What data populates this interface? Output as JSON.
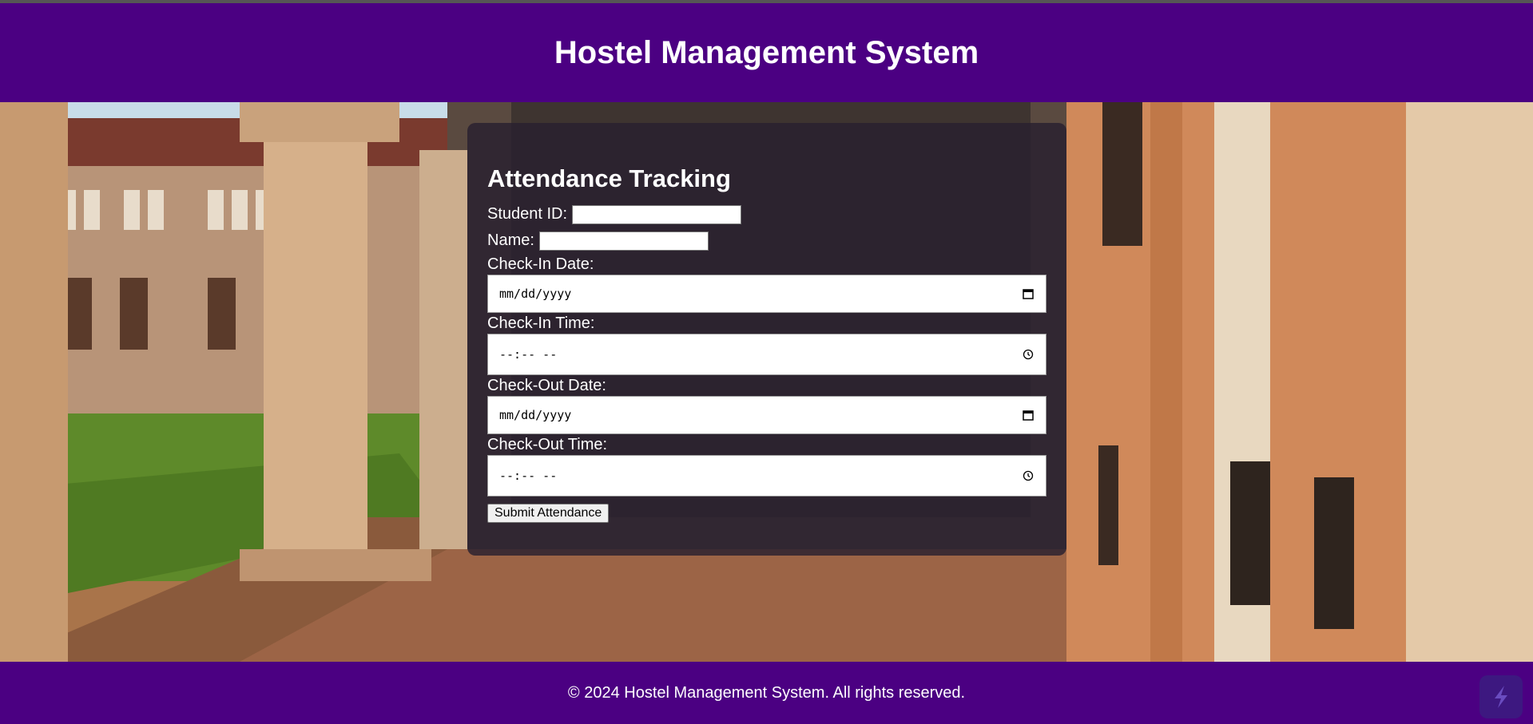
{
  "header": {
    "title": "Hostel Management System"
  },
  "form": {
    "title": "Attendance Tracking",
    "student_id_label": "Student ID:",
    "student_id_value": "",
    "name_label": "Name:",
    "name_value": "",
    "checkin_date_label": "Check-In Date:",
    "checkin_date_placeholder": "mm/dd/yyyy",
    "checkin_time_label": "Check-In Time:",
    "checkin_time_placeholder": "--:-- --",
    "checkout_date_label": "Check-Out Date:",
    "checkout_date_placeholder": "mm/dd/yyyy",
    "checkout_time_label": "Check-Out Time:",
    "checkout_time_placeholder": "--:-- --",
    "submit_label": "Submit Attendance"
  },
  "footer": {
    "text": "© 2024 Hostel Management System. All rights reserved."
  },
  "colors": {
    "brand": "#4b0082",
    "panel": "#282030"
  },
  "icons": {
    "date": "calendar-icon",
    "time": "clock-icon",
    "badge": "lightning-logo-icon"
  }
}
